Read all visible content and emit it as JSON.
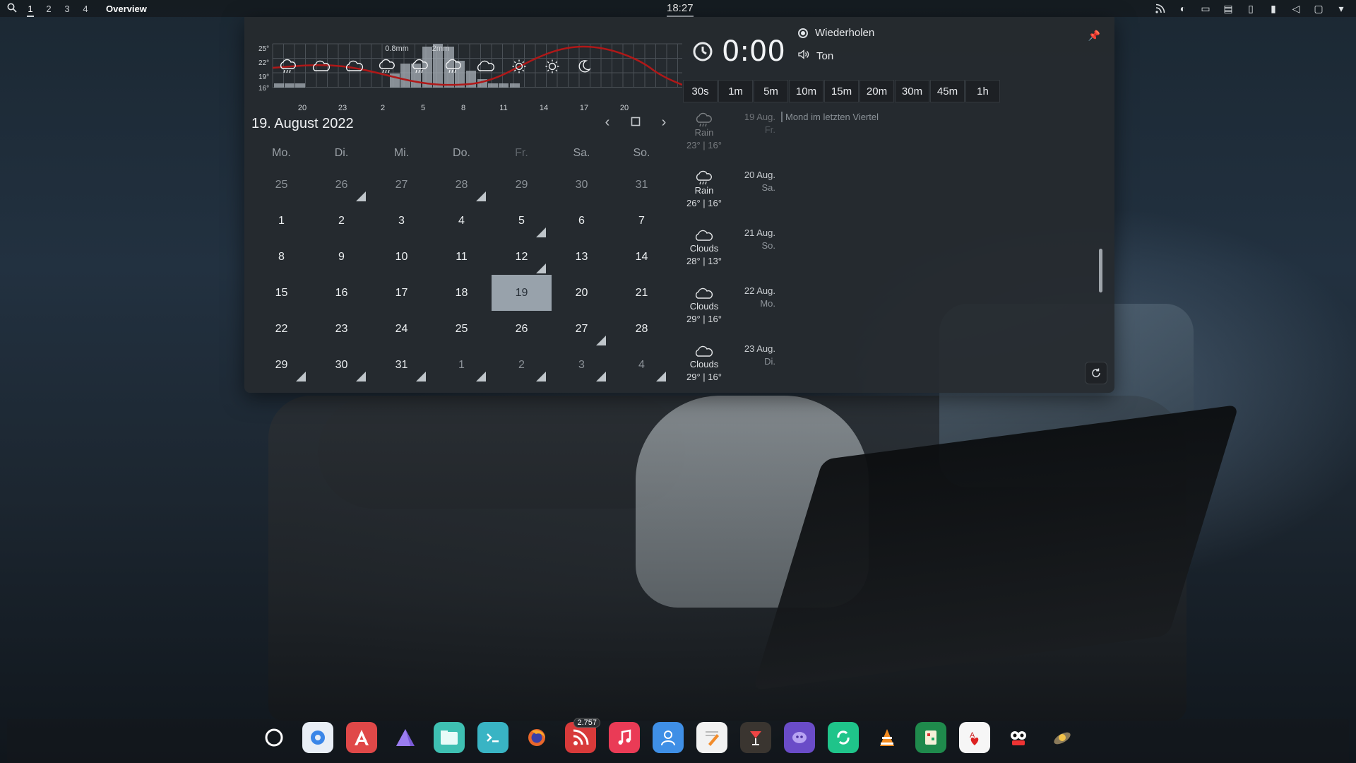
{
  "topbar": {
    "workspaces": [
      "1",
      "2",
      "3",
      "4"
    ],
    "overview_label": "Overview",
    "clock": "18:27"
  },
  "weather_graph": {
    "y_ticks": [
      "25°",
      "22°",
      "19°",
      "16°"
    ],
    "x_ticks": [
      "20",
      "23",
      "2",
      "5",
      "8",
      "11",
      "14",
      "17",
      "20"
    ],
    "precip_labels": [
      "0.8mm",
      "2mm"
    ],
    "icons": [
      "rain-icon",
      "clouds-icon",
      "clouds-icon",
      "rain-icon",
      "rain-icon",
      "rain-icon",
      "clouds-icon",
      "sun-icon",
      "sun-icon",
      "moon-icon"
    ]
  },
  "calendar": {
    "title": "19. August 2022",
    "weekdays": [
      "Mo.",
      "Di.",
      "Mi.",
      "Do.",
      "Fr.",
      "Sa.",
      "So."
    ],
    "weeks": [
      [
        {
          "d": "25",
          "out": true
        },
        {
          "d": "26",
          "out": true,
          "ev": true
        },
        {
          "d": "27",
          "out": true
        },
        {
          "d": "28",
          "out": true,
          "ev": true
        },
        {
          "d": "29",
          "out": true
        },
        {
          "d": "30",
          "out": true
        },
        {
          "d": "31",
          "out": true
        }
      ],
      [
        {
          "d": "1"
        },
        {
          "d": "2"
        },
        {
          "d": "3"
        },
        {
          "d": "4"
        },
        {
          "d": "5",
          "ev": true
        },
        {
          "d": "6"
        },
        {
          "d": "7"
        }
      ],
      [
        {
          "d": "8"
        },
        {
          "d": "9"
        },
        {
          "d": "10"
        },
        {
          "d": "11"
        },
        {
          "d": "12",
          "ev": true
        },
        {
          "d": "13"
        },
        {
          "d": "14"
        }
      ],
      [
        {
          "d": "15"
        },
        {
          "d": "16"
        },
        {
          "d": "17"
        },
        {
          "d": "18"
        },
        {
          "d": "19",
          "today": true
        },
        {
          "d": "20"
        },
        {
          "d": "21"
        }
      ],
      [
        {
          "d": "22"
        },
        {
          "d": "23"
        },
        {
          "d": "24"
        },
        {
          "d": "25"
        },
        {
          "d": "26"
        },
        {
          "d": "27",
          "ev": true
        },
        {
          "d": "28"
        }
      ],
      [
        {
          "d": "29",
          "ev": true
        },
        {
          "d": "30",
          "ev": true
        },
        {
          "d": "31",
          "ev": true
        },
        {
          "d": "1",
          "out": true,
          "ev": true
        },
        {
          "d": "2",
          "out": true,
          "ev": true
        },
        {
          "d": "3",
          "out": true,
          "ev": true
        },
        {
          "d": "4",
          "out": true,
          "ev": true
        }
      ]
    ]
  },
  "timer": {
    "value": "0:00",
    "repeat_label": "Wiederholen",
    "sound_label": "Ton",
    "presets": [
      "30s",
      "1m",
      "5m",
      "10m",
      "15m",
      "20m",
      "30m",
      "45m",
      "1h"
    ]
  },
  "forecast": [
    {
      "cond": "Rain",
      "temp": "23° | 16°",
      "date": "19 Aug.",
      "dow": "Fr.",
      "icon": "rain-icon",
      "dim": true
    },
    {
      "cond": "Rain",
      "temp": "26° | 16°",
      "date": "20 Aug.",
      "dow": "Sa.",
      "icon": "rain-icon"
    },
    {
      "cond": "Clouds",
      "temp": "28° | 13°",
      "date": "21 Aug.",
      "dow": "So.",
      "icon": "clouds-icon"
    },
    {
      "cond": "Clouds",
      "temp": "29° | 16°",
      "date": "22 Aug.",
      "dow": "Mo.",
      "icon": "clouds-icon"
    },
    {
      "cond": "Clouds",
      "temp": "29° | 16°",
      "date": "23 Aug.",
      "dow": "Di.",
      "icon": "clouds-icon"
    }
  ],
  "moon_event": "Mond im letzten Viertel",
  "dock": {
    "apps": [
      "activities-icon",
      "settings-icon",
      "appcenter-icon",
      "prism-icon",
      "files-icon",
      "terminal-icon",
      "firefox-icon",
      "rss-reader-icon",
      "music-icon",
      "contacts-icon",
      "text-editor-icon",
      "cocktail-icon",
      "chat-icon",
      "sync-icon",
      "vlc-icon",
      "mahjong-icon",
      "cards-icon",
      "game-icon",
      "satellite-icon"
    ],
    "rss_badge": "2.757"
  }
}
